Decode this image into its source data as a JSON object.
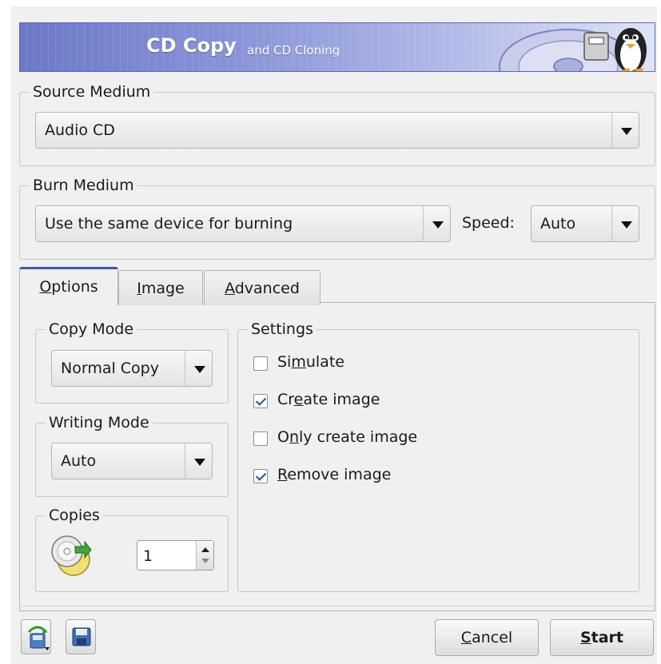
{
  "header": {
    "title": "CD Copy",
    "subtitle": "and CD Cloning"
  },
  "source_medium": {
    "label": "Source Medium",
    "selected": "Audio CD"
  },
  "burn_medium": {
    "label": "Burn Medium",
    "selected": "Use the same device for burning",
    "speed_label": "Speed:",
    "speed_selected": "Auto"
  },
  "tabs": [
    {
      "first": "O",
      "rest": "ptions"
    },
    {
      "first": "I",
      "rest": "mage"
    },
    {
      "first": "A",
      "rest": "dvanced"
    }
  ],
  "options": {
    "copy_mode": {
      "label": "Copy Mode",
      "selected": "Normal Copy"
    },
    "writing_mode": {
      "label": "Writing Mode",
      "selected": "Auto"
    },
    "copies": {
      "label": "Copies",
      "value": "1"
    },
    "settings": {
      "label": "Settings",
      "items": [
        {
          "pre": "Si",
          "mnemonic": "m",
          "post": "ulate",
          "checked": false
        },
        {
          "pre": "Cr",
          "mnemonic": "e",
          "post": "ate image",
          "checked": true
        },
        {
          "pre": "O",
          "mnemonic": "n",
          "post": "ly create image",
          "checked": false
        },
        {
          "pre": "",
          "mnemonic": "R",
          "post": "emove image",
          "checked": true
        }
      ]
    }
  },
  "buttons": {
    "cancel": {
      "mnemonic": "C",
      "rest": "ancel"
    },
    "start": {
      "mnemonic": "S",
      "rest": "tart"
    }
  },
  "icons": {
    "load_settings": "load-settings-icon",
    "save_settings": "save-icon",
    "copies": "cd-copies-icon"
  }
}
